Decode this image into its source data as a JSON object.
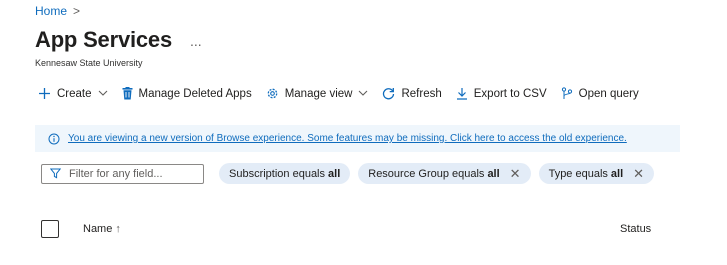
{
  "breadcrumb": {
    "home": "Home",
    "separator": ">"
  },
  "header": {
    "title": "App Services",
    "more": "...",
    "subtitle": "Kennesaw State University"
  },
  "toolbar": {
    "create": "Create",
    "manage_deleted": "Manage Deleted Apps",
    "manage_view": "Manage view",
    "refresh": "Refresh",
    "export_csv": "Export to CSV",
    "open_query": "Open query"
  },
  "banner": {
    "text": "You are viewing a new version of Browse experience. Some features may be missing. Click here to access the old experience."
  },
  "filters": {
    "placeholder": "Filter for any field...",
    "pills": [
      {
        "label": "Subscription equals",
        "value": "all"
      },
      {
        "label": "Resource Group equals",
        "value": "all"
      },
      {
        "label": "Type equals",
        "value": "all"
      }
    ]
  },
  "table": {
    "columns": {
      "name": "Name",
      "sort_arrow": "↑",
      "status": "Status"
    }
  },
  "colors": {
    "accent": "#0f6cbd",
    "banner_bg": "#eff6fc",
    "pill_bg": "#e3ecf7"
  }
}
